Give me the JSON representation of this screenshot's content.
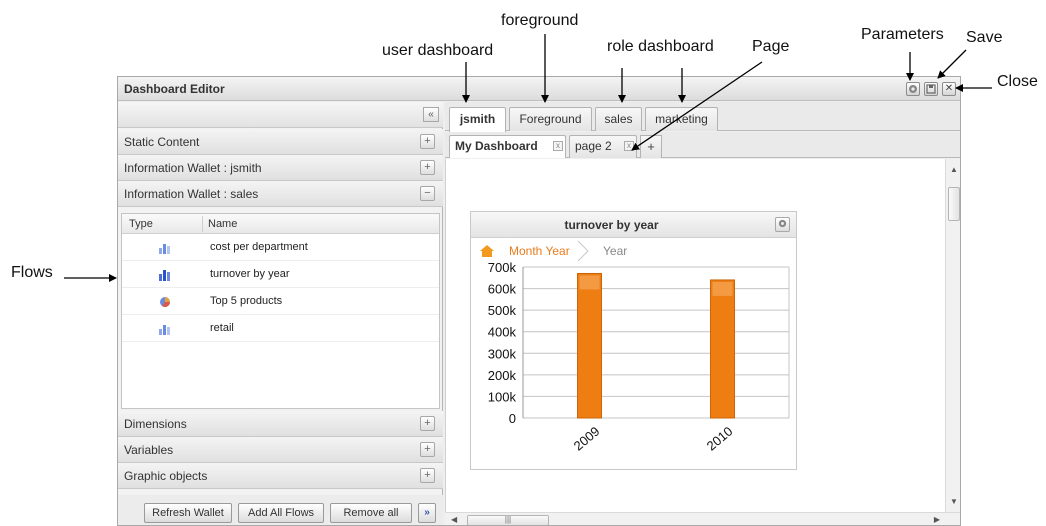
{
  "annotations": {
    "user_dashboard": "user dashboard",
    "foreground": "foreground",
    "role_dashboard": "role dashboard",
    "page": "Page",
    "parameters": "Parameters",
    "save": "Save",
    "close": "Close",
    "flows": "Flows"
  },
  "window": {
    "title": "Dashboard Editor",
    "controls": {
      "parameters_icon": "gear-icon",
      "save_icon": "save-icon",
      "close_glyph": "✕"
    }
  },
  "left_panel": {
    "collapse_glyph": "«",
    "sections": {
      "static_content": {
        "label": "Static Content",
        "toggle": "+"
      },
      "wallet_jsmith": {
        "label": "Information Wallet : jsmith",
        "toggle": "+"
      },
      "wallet_sales": {
        "label": "Information Wallet : sales",
        "toggle": "−"
      },
      "dimensions": {
        "label": "Dimensions",
        "toggle": "+"
      },
      "variables": {
        "label": "Variables",
        "toggle": "+"
      },
      "graphic_objects": {
        "label": "Graphic objects",
        "toggle": "+"
      }
    },
    "grid": {
      "col_type": "Type",
      "col_name": "Name",
      "rows": [
        {
          "name": "cost per department",
          "icon": "bar-chart-icon"
        },
        {
          "name": "turnover by year",
          "icon": "bar-chart-icon"
        },
        {
          "name": "Top 5 products",
          "icon": "pie-chart-icon"
        },
        {
          "name": "retail",
          "icon": "bar-chart-icon"
        }
      ]
    },
    "buttons": {
      "refresh": "Refresh Wallet",
      "add_all": "Add All Flows",
      "remove_all": "Remove all",
      "more": "»"
    }
  },
  "dashboard_tabs": {
    "jsmith": "jsmith",
    "foreground": "Foreground",
    "sales": "sales",
    "marketing": "marketing"
  },
  "page_tabs": {
    "my_dashboard": "My Dashboard",
    "page2": "page 2",
    "close_glyph": "x",
    "add": "+"
  },
  "widget": {
    "title": "turnover by year",
    "breadcrumb": {
      "active": "Month Year",
      "next": "Year"
    }
  },
  "colors": {
    "bar": "#ee7d12",
    "bar_highlight": "#f7b26a",
    "accent": "#e87c1e"
  },
  "chart_data": {
    "type": "bar",
    "title": "turnover by year",
    "categories": [
      "2009",
      "2010"
    ],
    "values": [
      670000,
      640000
    ],
    "ylim": [
      0,
      700000
    ],
    "yticks": [
      "0",
      "100k",
      "200k",
      "300k",
      "400k",
      "500k",
      "600k",
      "700k"
    ],
    "grid": true,
    "legend": "none"
  }
}
